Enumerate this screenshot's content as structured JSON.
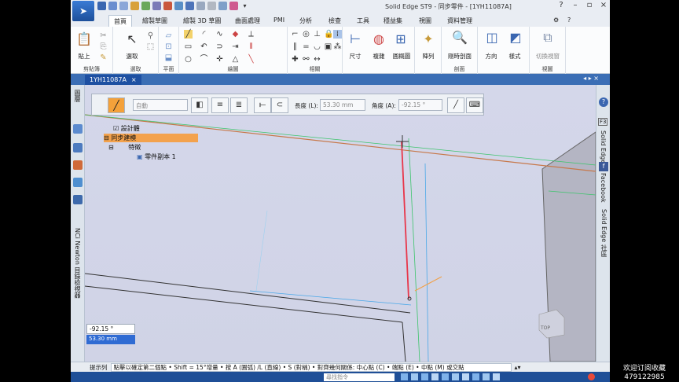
{
  "window": {
    "title": "Solid Edge ST9 - 同步零件 - [1YH11087A]"
  },
  "tabs": [
    {
      "label": "首頁"
    },
    {
      "label": "繪製草圖"
    },
    {
      "label": "繪製 3D 草圖"
    },
    {
      "label": "曲面處理"
    },
    {
      "label": "PMI"
    },
    {
      "label": "分析"
    },
    {
      "label": "檢查"
    },
    {
      "label": "工具"
    },
    {
      "label": "穩益集"
    },
    {
      "label": "視圖"
    },
    {
      "label": "資料管理"
    }
  ],
  "ribbon": {
    "groups": {
      "clipboard": "剪貼簿",
      "select": "選取",
      "plane": "平面",
      "draw": "繪圖",
      "relate": "相關",
      "view_group": "剖面",
      "view2": "視圖"
    },
    "buttons": {
      "paste": "貼上",
      "select": "選取",
      "dimension": "尺寸",
      "deflect": "複雜",
      "mesh": "圓概圖",
      "arrange": "陣列",
      "section": "剛時剖面",
      "direction": "方向",
      "style": "樣式",
      "last_view": "切換視窗"
    }
  },
  "document_tab": {
    "label": "1YH11087A",
    "close": "×"
  },
  "command_bar": {
    "mode_select": "自動",
    "length_label": "長度 (L):",
    "length_value": "53.30 mm",
    "angle_label": "角度 (A):",
    "angle_value": "-92.15 °"
  },
  "tree": {
    "items": [
      {
        "label": "設計體"
      },
      {
        "label": "同步建模"
      },
      {
        "label": "特徵"
      },
      {
        "label": "零件副本 1"
      }
    ]
  },
  "left_bar": {
    "vertical_text_1": "圖層",
    "vertical_text_2": "NCi Newton 目錄檢視器"
  },
  "right_bar": {
    "badge": "F3",
    "vertical_text_1": "Solid Edge",
    "vertical_text_2": "Facebook",
    "vertical_text_3": "Solid Edge 社區"
  },
  "readout": {
    "angle": "-92.15 °",
    "length": "53.30 mm"
  },
  "prompt": {
    "label": "提示列",
    "text": "點擊以確定第二個點 • Shift = 15°增量 • 按 A (圓弧) /L (直線) • S (對稱) • 對齊幾何關係: 中心點 (C) • 端點 (E) • 中點 (M) 或交點"
  },
  "status": {
    "find_placeholder": "尋找指令"
  },
  "view_cube": {
    "label": "TOP"
  },
  "watermark": {
    "line1": "欢迎订阅收藏",
    "line2": "479122985"
  },
  "colors": {
    "ribbon_blue": "#3b6eb5",
    "sketch_line": "#e8364a",
    "highlight": "#f3a24d"
  }
}
